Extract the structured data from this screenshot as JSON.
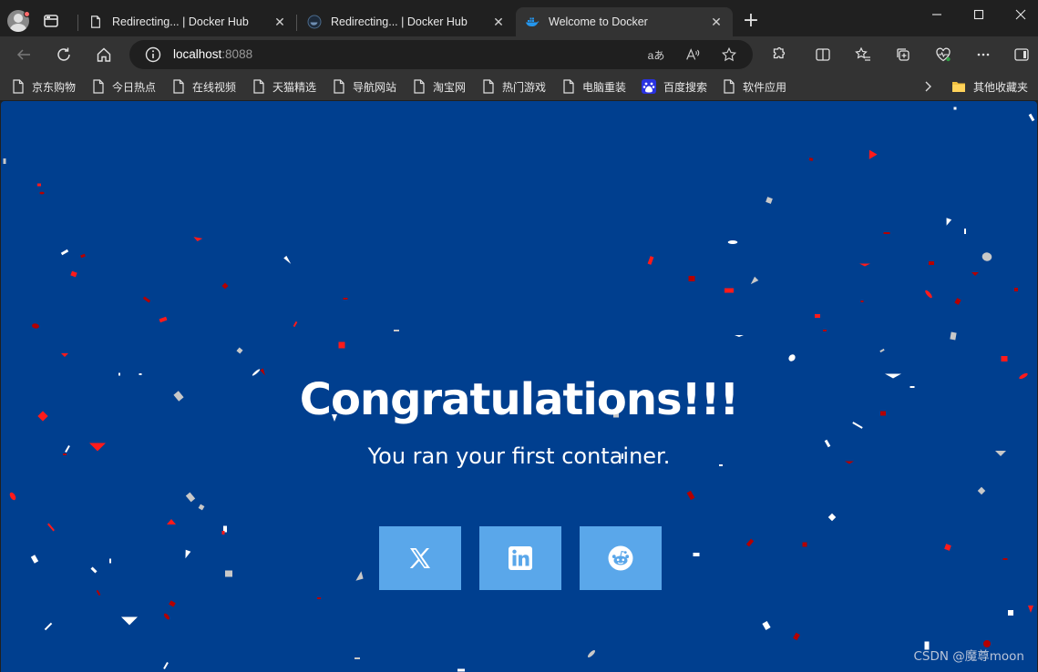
{
  "browser": {
    "tabs": [
      {
        "title": "Redirecting... | Docker Hub",
        "icon": "page-icon",
        "active": false
      },
      {
        "title": "Redirecting... | Docker Hub",
        "icon": "docker-dark-icon",
        "active": false
      },
      {
        "title": "Welcome to Docker",
        "icon": "docker-whale-icon",
        "active": true
      }
    ],
    "new_tab_label": "+",
    "close_glyph": "✕",
    "address": {
      "host": "localhost",
      "port": ":8088"
    },
    "reader_glyph": "aあ",
    "read_aloud_glyph": "Aͅ",
    "bookmarks": [
      {
        "label": "京东购物",
        "icon": "page-icon"
      },
      {
        "label": "今日热点",
        "icon": "page-icon"
      },
      {
        "label": "在线视频",
        "icon": "page-icon"
      },
      {
        "label": "天猫精选",
        "icon": "page-icon"
      },
      {
        "label": "导航网站",
        "icon": "page-icon"
      },
      {
        "label": "淘宝网",
        "icon": "page-icon"
      },
      {
        "label": "热门游戏",
        "icon": "page-icon"
      },
      {
        "label": "电脑重装",
        "icon": "page-icon"
      },
      {
        "label": "百度搜索",
        "icon": "baidu-icon"
      },
      {
        "label": "软件应用",
        "icon": "page-icon"
      }
    ],
    "other_bookmarks": "其他收藏夹"
  },
  "page": {
    "headline": "Congratulations!!!",
    "subline": "You ran your first container.",
    "social_buttons": [
      "x-twitter-icon",
      "linkedin-icon",
      "reddit-icon"
    ],
    "background_color": "#003f8f",
    "button_color": "#5aa7ea"
  },
  "watermark": "CSDN @魔尊moon"
}
